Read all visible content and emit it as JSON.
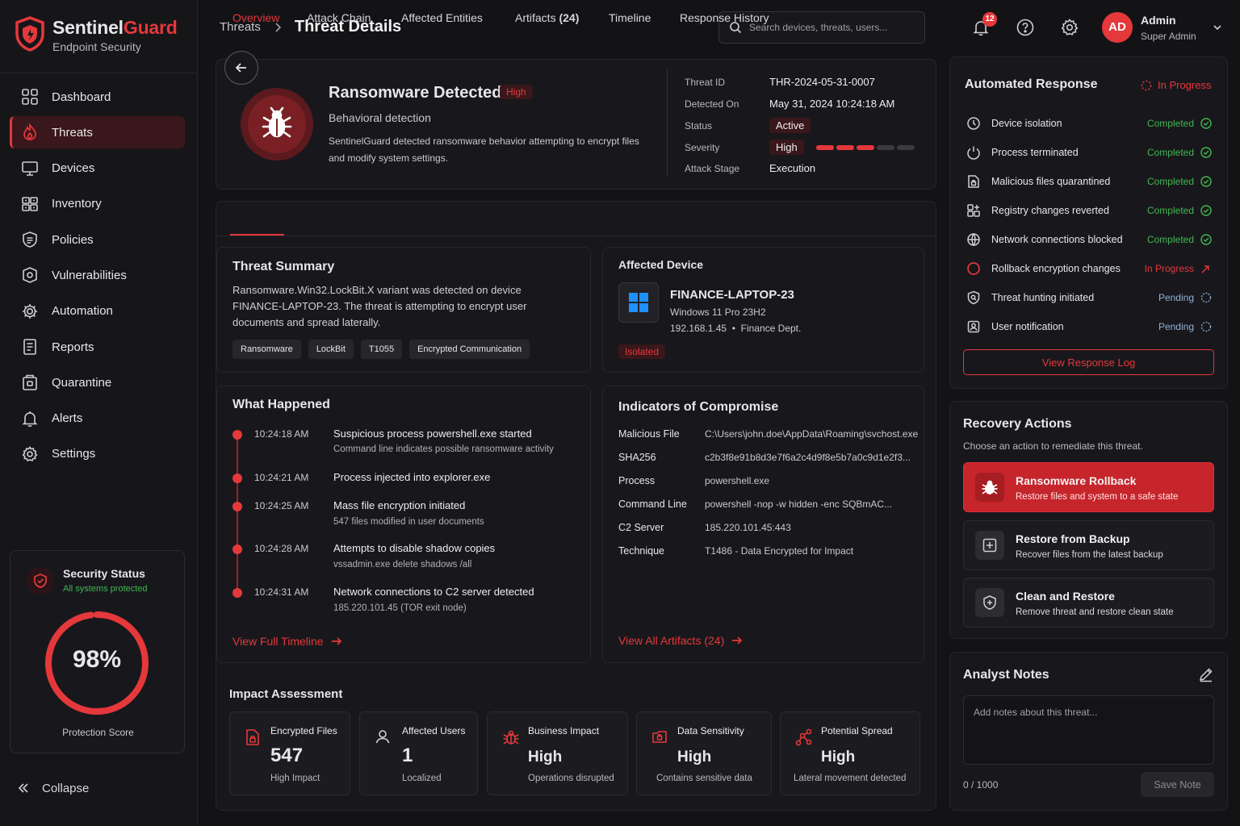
{
  "brand": {
    "name_part1": "Sentinel",
    "name_part2": "Guard",
    "subtitle": "Endpoint Security"
  },
  "nav": [
    {
      "label": "Dashboard",
      "icon": "grid-icon"
    },
    {
      "label": "Threats",
      "icon": "flame-icon",
      "active": true
    },
    {
      "label": "Devices",
      "icon": "monitor-icon"
    },
    {
      "label": "Inventory",
      "icon": "inventory-icon"
    },
    {
      "label": "Policies",
      "icon": "policy-icon"
    },
    {
      "label": "Vulnerabilities",
      "icon": "shield-icon"
    },
    {
      "label": "Automation",
      "icon": "automation-gear-icon"
    },
    {
      "label": "Reports",
      "icon": "report-icon"
    },
    {
      "label": "Quarantine",
      "icon": "quarantine-icon"
    },
    {
      "label": "Alerts",
      "icon": "bell-icon"
    },
    {
      "label": "Settings",
      "icon": "gear-icon"
    }
  ],
  "security_status": {
    "title": "Security Status",
    "subtitle": "All systems protected",
    "score": "98%",
    "score_value": 0.98,
    "score_label": "Protection Score"
  },
  "collapse_label": "Collapse",
  "breadcrumb": {
    "parent": "Threats",
    "current": "Threat Details"
  },
  "search": {
    "placeholder": "Search devices, threats, users..."
  },
  "notifications": {
    "count": "12"
  },
  "user": {
    "initials": "AD",
    "name": "Admin",
    "role": "Super Admin"
  },
  "threat": {
    "title": "Ransomware Detected",
    "severity_pill": "High",
    "detection": "Behavioral detection",
    "description": "SentinelGuard detected ransomware behavior attempting to encrypt files and modify system settings.",
    "meta": {
      "id_label": "Threat ID",
      "id": "THR-2024-05-31-0007",
      "detected_label": "Detected On",
      "detected": "May 31, 2024 10:24:18 AM",
      "status_label": "Status",
      "status": "Active",
      "severity_label": "Severity",
      "severity": "High",
      "severity_level": 3,
      "severity_max": 5,
      "stage_label": "Attack Stage",
      "stage": "Execution"
    }
  },
  "tabs": [
    {
      "label": "Overview",
      "active": true
    },
    {
      "label": "Attack Chain"
    },
    {
      "label": "Affected Entities"
    },
    {
      "label": "Artifacts",
      "count": "(24)"
    },
    {
      "label": "Timeline"
    },
    {
      "label": "Response History"
    }
  ],
  "summary": {
    "title": "Threat Summary",
    "text": "Ransomware.Win32.LockBit.X variant was detected on device FINANCE-LAPTOP-23. The threat is attempting to encrypt user documents and spread laterally.",
    "tags": [
      "Ransomware",
      "LockBit",
      "T1055",
      "Encrypted Communication"
    ]
  },
  "device": {
    "title": "Affected Device",
    "name": "FINANCE-LAPTOP-23",
    "os": "Windows 11 Pro 23H2",
    "ip": "192.168.1.45",
    "dept": "Finance Dept.",
    "status": "Isolated"
  },
  "what_happened": {
    "title": "What Happened",
    "events": [
      {
        "time": "10:24:18 AM",
        "title": "Suspicious process powershell.exe started",
        "sub": "Command line indicates possible ransomware activity"
      },
      {
        "time": "10:24:21 AM",
        "title": "Process injected into explorer.exe",
        "sub": ""
      },
      {
        "time": "10:24:25 AM",
        "title": "Mass file encryption initiated",
        "sub": "547 files modified in user documents"
      },
      {
        "time": "10:24:28 AM",
        "title": "Attempts to disable shadow copies",
        "sub": "vssadmin.exe delete shadows /all"
      },
      {
        "time": "10:24:31 AM",
        "title": "Network connections to C2 server detected",
        "sub": "185.220.101.45 (TOR exit node)"
      }
    ],
    "link": "View Full Timeline"
  },
  "ioc": {
    "title": "Indicators of Compromise",
    "rows": [
      {
        "key": "Malicious File",
        "value": "C:\\Users\\john.doe\\AppData\\Roaming\\svchost.exe"
      },
      {
        "key": "SHA256",
        "value": "c2b3f8e91b8d3e7f6a2c4d9f8e5b7a0c9d1e2f3..."
      },
      {
        "key": "Process",
        "value": "powershell.exe"
      },
      {
        "key": "Command Line",
        "value": "powershell -nop -w hidden -enc SQBmAC..."
      },
      {
        "key": "C2 Server",
        "value": "185.220.101.45:443"
      },
      {
        "key": "Technique",
        "value": "T1486 - Data Encrypted for Impact"
      }
    ],
    "link": "View All Artifacts (24)"
  },
  "impact": {
    "title": "Impact Assessment",
    "cards": [
      {
        "label": "Encrypted Files",
        "value": "547",
        "sub": "High Impact"
      },
      {
        "label": "Affected Users",
        "value": "1",
        "sub": "Localized"
      },
      {
        "label": "Business Impact",
        "value": "High",
        "sub": "Operations disrupted"
      },
      {
        "label": "Data Sensitivity",
        "value": "High",
        "sub": "Contains sensitive data"
      },
      {
        "label": "Potential Spread",
        "value": "High",
        "sub": "Lateral movement detected"
      }
    ]
  },
  "automated_response": {
    "title": "Automated Response",
    "status": "In Progress",
    "rows": [
      {
        "label": "Device isolation",
        "status": "Completed"
      },
      {
        "label": "Process terminated",
        "status": "Completed"
      },
      {
        "label": "Malicious files quarantined",
        "status": "Completed"
      },
      {
        "label": "Registry changes reverted",
        "status": "Completed"
      },
      {
        "label": "Network connections blocked",
        "status": "Completed"
      },
      {
        "label": "Rollback encryption changes",
        "status": "In Progress"
      },
      {
        "label": "Threat hunting initiated",
        "status": "Pending"
      },
      {
        "label": "User notification",
        "status": "Pending"
      }
    ],
    "button": "View Response Log"
  },
  "recovery": {
    "title": "Recovery Actions",
    "subtitle": "Choose an action to remediate this threat.",
    "actions": [
      {
        "title": "Ransomware Rollback",
        "sub": "Restore files and system to a safe state"
      },
      {
        "title": "Restore from Backup",
        "sub": "Recover files from the latest backup"
      },
      {
        "title": "Clean and Restore",
        "sub": "Remove threat and restore clean state"
      }
    ]
  },
  "notes": {
    "title": "Analyst Notes",
    "placeholder": "Add notes about this threat...",
    "count": "0 / 1000",
    "save": "Save Note"
  },
  "colors": {
    "accent": "#e5383b",
    "success": "#3fb950",
    "pending": "#8fb3d9",
    "background": "#131316"
  }
}
